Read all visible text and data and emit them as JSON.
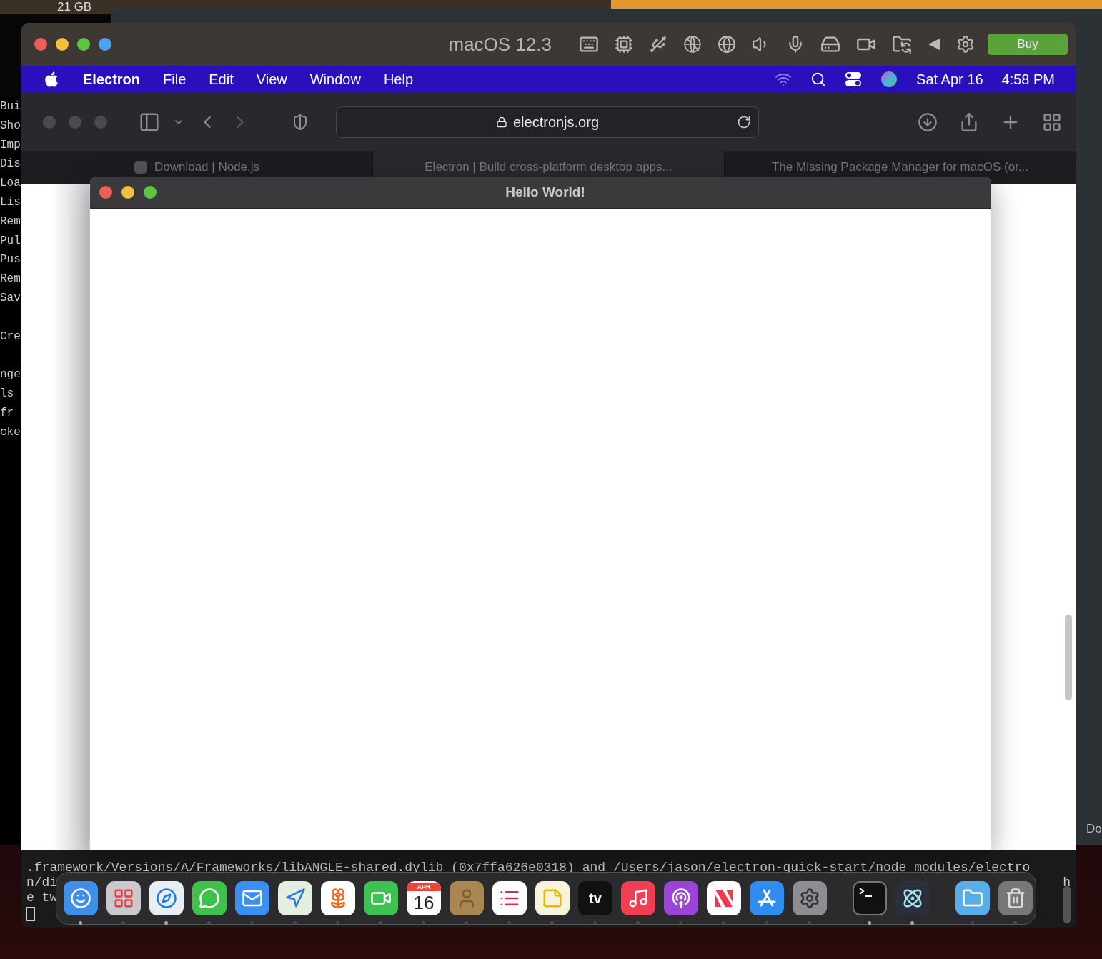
{
  "status_strip": {
    "memory": "21 GB"
  },
  "left_terminal": {
    "lines": [
      {
        "text": "Bui",
        "gap": false
      },
      {
        "text": "Sho",
        "gap": false
      },
      {
        "text": "Imp",
        "gap": false
      },
      {
        "text": "Dis",
        "gap": false
      },
      {
        "text": "Loa",
        "gap": false
      },
      {
        "text": "Lis",
        "gap": false
      },
      {
        "text": "Rem",
        "gap": false
      },
      {
        "text": "Pul",
        "gap": false
      },
      {
        "text": "Pus",
        "gap": false
      },
      {
        "text": "Rem",
        "gap": false
      },
      {
        "text": "Sav",
        "gap": false
      },
      {
        "text": "Cre",
        "gap": true
      },
      {
        "text": "nge",
        "gap": true
      },
      {
        "text": "ls",
        "gap": false
      },
      {
        "text": "fr",
        "gap": false
      },
      {
        "text": "cke",
        "gap": false
      }
    ]
  },
  "vm_window": {
    "title": "macOS 12.3",
    "buy_button": "Buy"
  },
  "menu_bar": {
    "items": [
      {
        "label": "Electron",
        "kind": "app"
      },
      {
        "label": "File",
        "kind": "menu"
      },
      {
        "label": "Edit",
        "kind": "menu"
      },
      {
        "label": "View",
        "kind": "menu"
      },
      {
        "label": "Window",
        "kind": "menu"
      },
      {
        "label": "Help",
        "kind": "menu"
      }
    ],
    "date": "Sat Apr 16",
    "time": "4:58 PM"
  },
  "browser": {
    "address": "electronjs.org",
    "tabs": [
      {
        "label": "Download | Node.js",
        "selected": false,
        "favicon": true
      },
      {
        "label": "Electron | Build cross-platform desktop apps...",
        "selected": true,
        "favicon": false
      },
      {
        "label": "The Missing Package Manager for macOS (or...",
        "selected": false,
        "favicon": false
      }
    ]
  },
  "app_window": {
    "title": "Hello World!"
  },
  "terminal": {
    "lines": [
      {
        "left": ".framework/Versions/A/Frameworks/libANGLE-shared.dylib (0x7ffa626e0318) and /Users/jason/electron-quick-start/node_modules/electro"
      },
      {
        "left": "n/di",
        "right": "h"
      },
      {
        "left": "e tw"
      }
    ]
  },
  "dock": {
    "apps": [
      {
        "kind": "finder",
        "running": true
      },
      {
        "kind": "launchpad",
        "running": false
      },
      {
        "kind": "safari",
        "running": true
      },
      {
        "kind": "messages",
        "running": false
      },
      {
        "kind": "mail",
        "running": false
      },
      {
        "kind": "maps",
        "running": false
      },
      {
        "kind": "photos",
        "running": false
      },
      {
        "kind": "facetime",
        "running": false
      },
      {
        "kind": "calendar",
        "running": false,
        "month": "APR",
        "day": "16"
      },
      {
        "kind": "contacts",
        "running": false
      },
      {
        "kind": "reminders",
        "running": false
      },
      {
        "kind": "notes",
        "running": false
      },
      {
        "kind": "tv",
        "running": false,
        "label": "tv"
      },
      {
        "kind": "music",
        "running": false
      },
      {
        "kind": "podcasts",
        "running": false
      },
      {
        "kind": "news",
        "running": false
      },
      {
        "kind": "appstore",
        "running": false
      },
      {
        "kind": "preferences",
        "running": false
      },
      {
        "kind": "separator"
      },
      {
        "kind": "terminal",
        "running": true
      },
      {
        "kind": "electron",
        "running": true
      },
      {
        "kind": "separator"
      },
      {
        "kind": "downloads",
        "running": false
      },
      {
        "kind": "trash",
        "running": false
      }
    ]
  },
  "side_label": "Do"
}
